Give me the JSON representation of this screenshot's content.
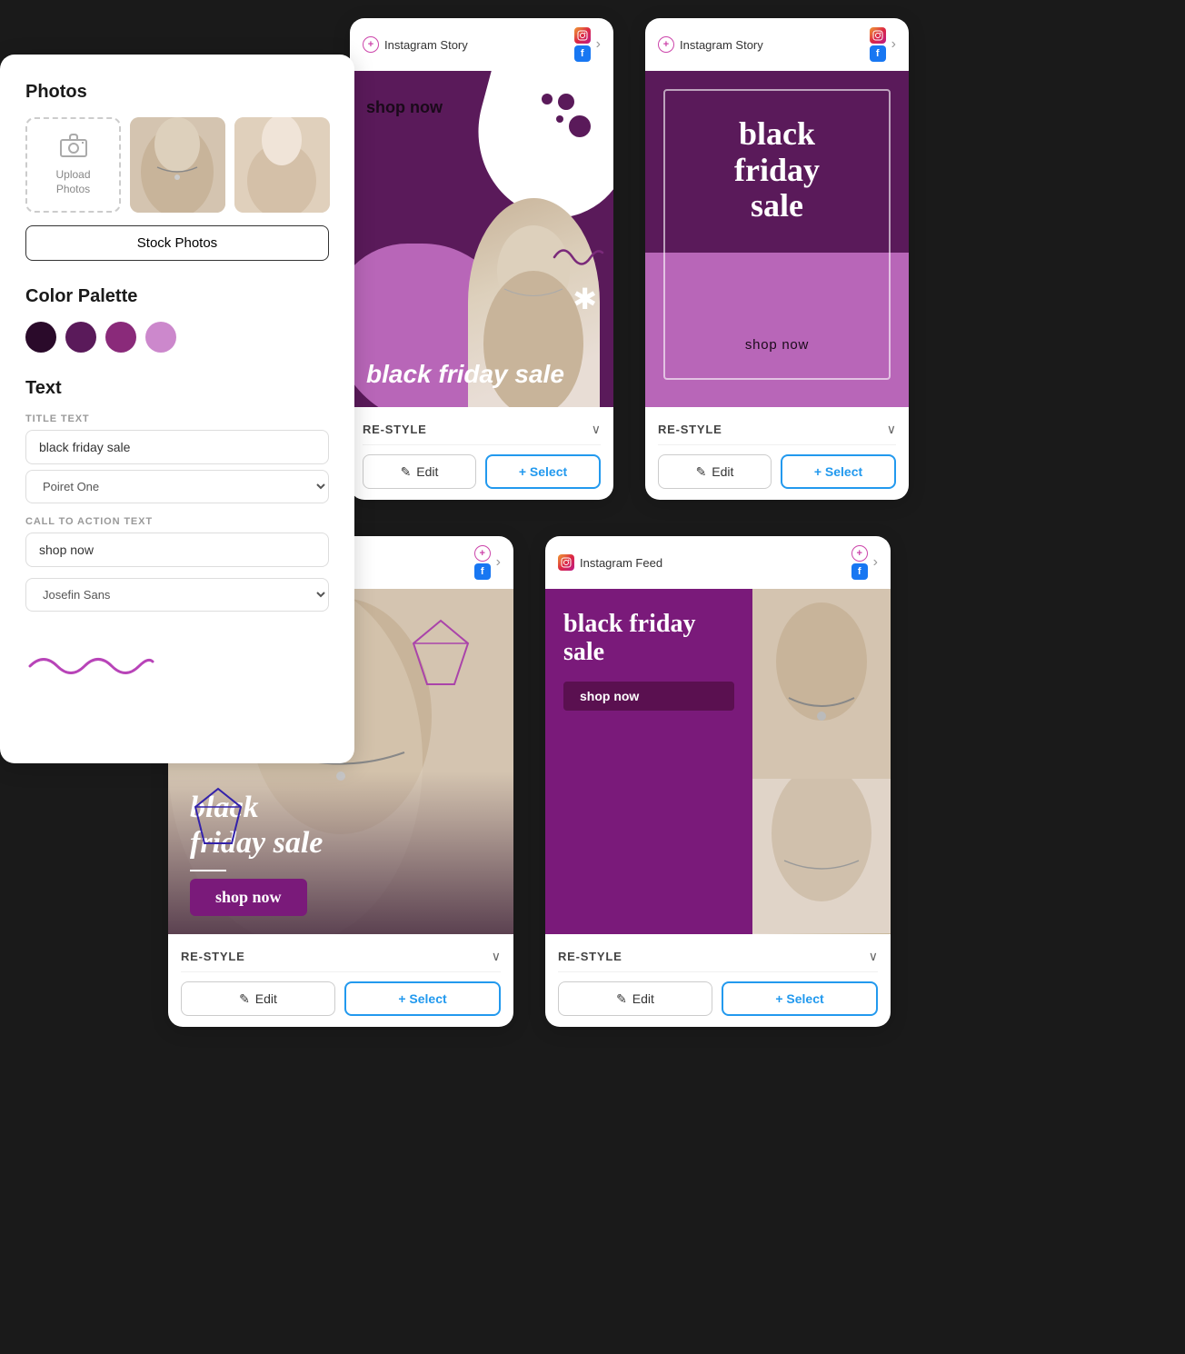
{
  "leftPanel": {
    "photosTitle": "Photos",
    "uploadLabel": "Upload\nPhotos",
    "stockPhotosBtn": "Stock Photos",
    "colorPaletteTitle": "Color Palette",
    "colors": [
      {
        "hex": "#2a0a2a",
        "label": "dark-purple"
      },
      {
        "hex": "#5a1a5a",
        "label": "medium-purple"
      },
      {
        "hex": "#8a2a7a",
        "label": "plum"
      },
      {
        "hex": "#cc88cc",
        "label": "light-purple"
      }
    ],
    "textTitle": "Text",
    "titleTextLabel": "TITLE TEXT",
    "titleTextValue": "black friday sale",
    "fontSelector1": "Poiret One",
    "ctaLabel": "CALL TO ACTION TEXT",
    "ctaValue": "shop now",
    "fontSelector2": "Josefin Sans"
  },
  "cards": [
    {
      "id": "card-1",
      "type": "Instagram Story",
      "platform": "instagram",
      "templateTitle": "black friday sale",
      "shopNow": "shop now",
      "restyleLabel": "RE-STYLE",
      "editBtn": "✎ Edit",
      "selectBtn": "+ Select"
    },
    {
      "id": "card-2",
      "type": "Instagram Story",
      "platform": "instagram",
      "templateTitle": "black friday sale",
      "shopNow": "shop now",
      "restyleLabel": "RE-STYLE",
      "editBtn": "✎ Edit",
      "selectBtn": "+ Select"
    },
    {
      "id": "card-3",
      "type": "Instagram Feed",
      "platform": "instagram",
      "templateTitle": "black friday sale",
      "shopNow": "shop now",
      "restyleLabel": "RE-STYLE",
      "editBtn": "✎ Edit",
      "selectBtn": "+ Select"
    },
    {
      "id": "card-4",
      "type": "Instagram Feed",
      "platform": "instagram",
      "templateTitle": "black friday sale",
      "shopNow": "shop now",
      "restyleLabel": "RE-STYLE",
      "editBtn": "✎ Edit",
      "selectBtn": "+ Select"
    }
  ]
}
